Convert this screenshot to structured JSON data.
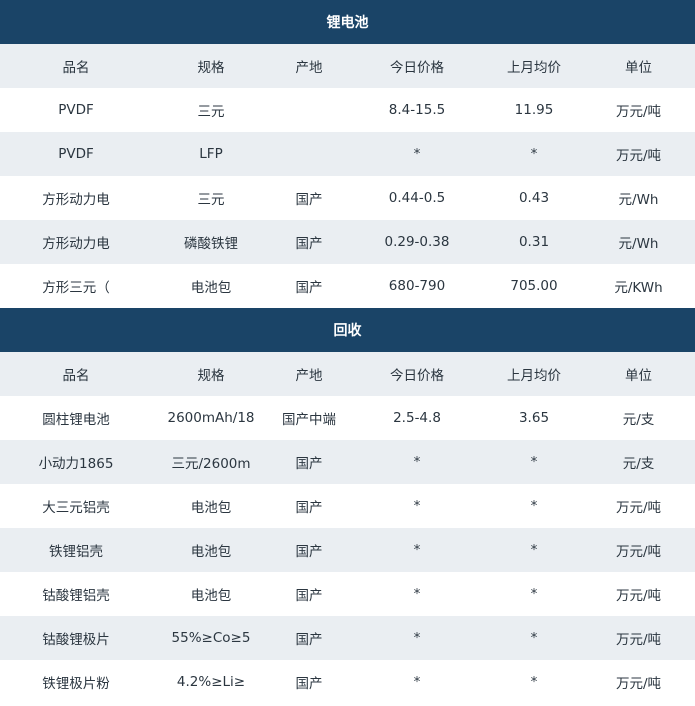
{
  "section1": {
    "title": "锂电池",
    "columns": [
      "品名",
      "规格",
      "产地",
      "今日价格",
      "上月均价",
      "单位"
    ],
    "rows": [
      [
        "PVDF",
        "三元",
        "",
        "8.4-15.5",
        "11.95",
        "万元/吨"
      ],
      [
        "PVDF",
        "LFP",
        "",
        "*",
        "*",
        "万元/吨"
      ],
      [
        "方形动力电",
        "三元",
        "国产",
        "0.44-0.5",
        "0.43",
        "元/Wh"
      ],
      [
        "方形动力电",
        "磷酸铁锂",
        "国产",
        "0.29-0.38",
        "0.31",
        "元/Wh"
      ],
      [
        "方形三元（",
        "电池包",
        "国产",
        "680-790",
        "705.00",
        "元/KWh"
      ]
    ]
  },
  "section2": {
    "title": "回收",
    "columns": [
      "品名",
      "规格",
      "产地",
      "今日价格",
      "上月均价",
      "单位"
    ],
    "rows": [
      [
        "圆柱锂电池",
        "2600mAh/18",
        "国产中端",
        "2.5-4.8",
        "3.65",
        "元/支"
      ],
      [
        "小动力1865",
        "三元/2600m",
        "国产",
        "*",
        "*",
        "元/支"
      ],
      [
        "大三元铝壳",
        "电池包",
        "国产",
        "*",
        "*",
        "万元/吨"
      ],
      [
        "铁锂铝壳",
        "电池包",
        "国产",
        "*",
        "*",
        "万元/吨"
      ],
      [
        "钴酸锂铝壳",
        "电池包",
        "国产",
        "*",
        "*",
        "万元/吨"
      ],
      [
        "钴酸锂极片",
        "55%≥Co≥5",
        "国产",
        "*",
        "*",
        "万元/吨"
      ],
      [
        "铁锂极片粉",
        "4.2%≥Li≥",
        "国产",
        "*",
        "*",
        "万元/吨"
      ]
    ]
  },
  "colors": {
    "header_bg": "#1a4467",
    "alt_row_bg": "#eaeef2",
    "text": "#2b3640"
  }
}
